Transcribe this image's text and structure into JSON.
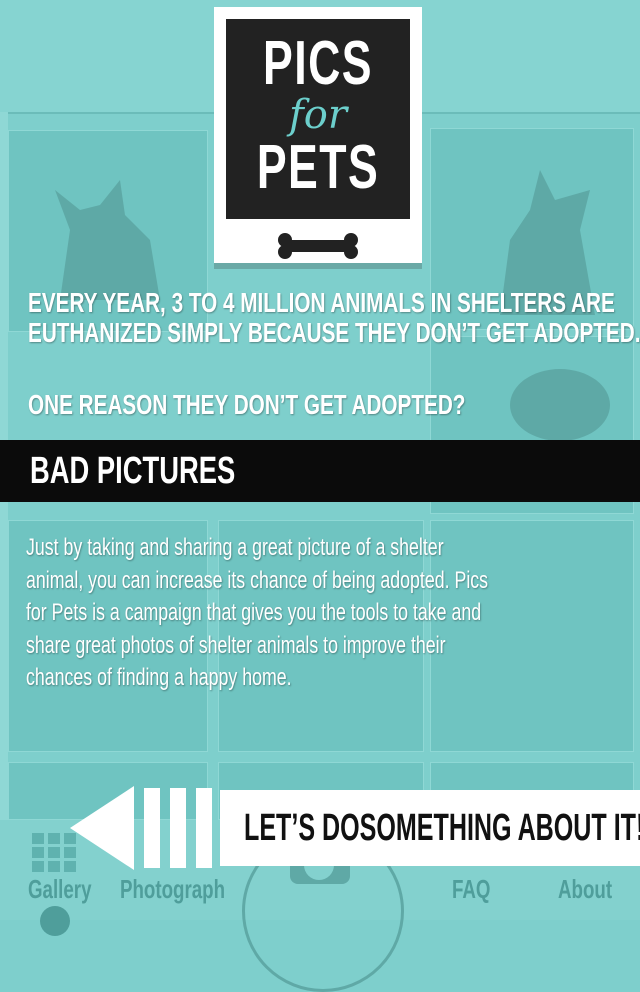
{
  "logo": {
    "line1": "PICS",
    "line2": "for",
    "line3": "PETS",
    "accent_color": "#6ccfcc"
  },
  "intro": {
    "line1": "EVERY YEAR, 3 TO 4 MILLION ANIMALS IN SHELTERS ARE",
    "line2": "EUTHANIZED SIMPLY BECAUSE THEY DON’T GET ADOPTED.",
    "question": "ONE REASON THEY DON’T GET ADOPTED?"
  },
  "band": {
    "text": "BAD PICTURES"
  },
  "body": {
    "lines": [
      "Just by taking and sharing a great picture of a shelter",
      "animal, you can increase its chance of being adopted. Pics",
      "for Pets is a campaign that gives you the tools to take and",
      "share great photos of shelter animals to improve their",
      "chances of finding a happy home."
    ]
  },
  "cta": {
    "label": "LET’S DOSOMETHING ABOUT IT!",
    "arrow_icon": "back-arrow-icon"
  },
  "nav": {
    "gallery": "Gallery",
    "photograph": "Photograph",
    "faq": "FAQ",
    "about": "About"
  },
  "colors": {
    "background": "#7ecfcc",
    "band": "#0b0b0b",
    "text": "#ffffff"
  }
}
